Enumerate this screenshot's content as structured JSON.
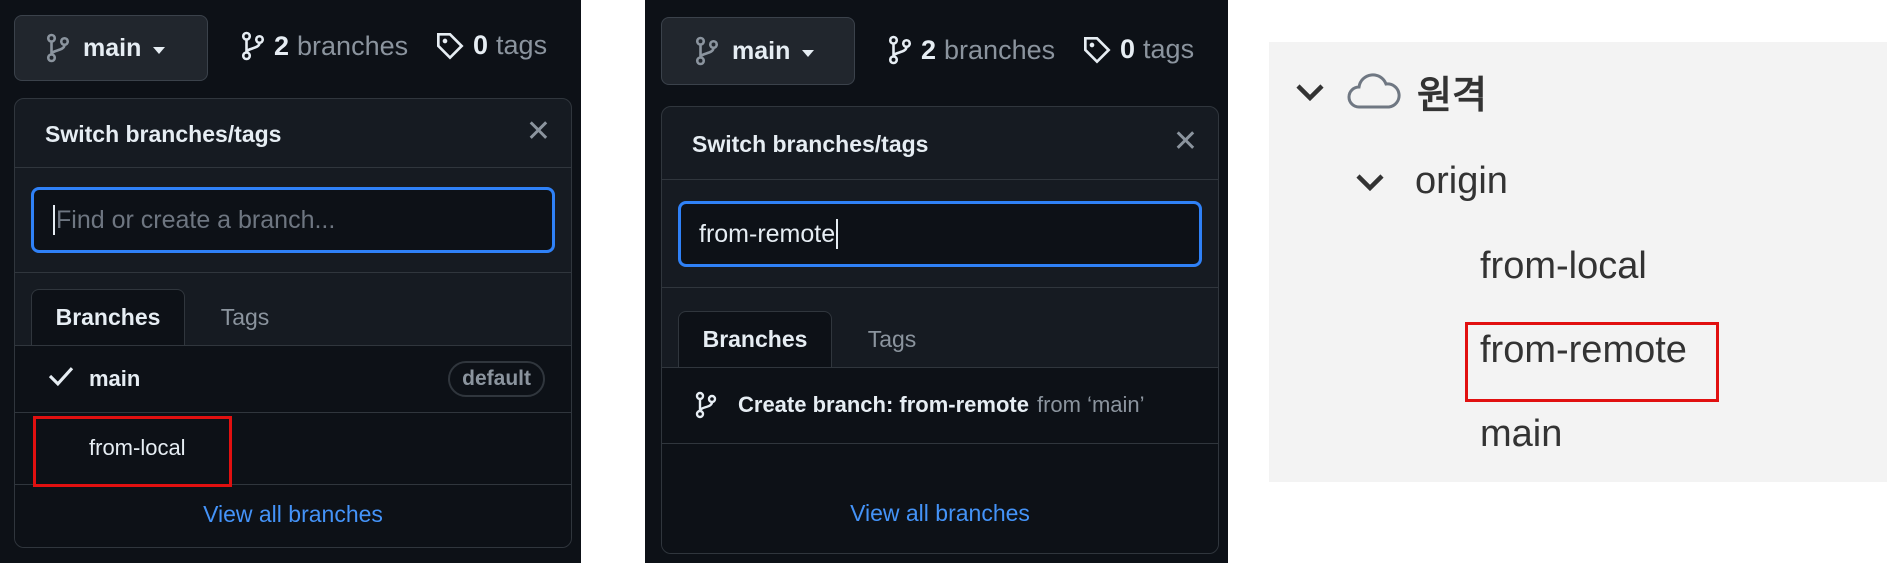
{
  "panel1": {
    "branch_button": "main",
    "branch_count": "2",
    "branches_word": "branches",
    "tag_count": "0",
    "tags_word": "tags",
    "dropdown_title": "Switch branches/tags",
    "search_placeholder": "Find or create a branch...",
    "tabs": [
      "Branches",
      "Tags"
    ],
    "branch_list": [
      {
        "name": "main",
        "badge": "default"
      },
      {
        "name": "from-local"
      }
    ],
    "view_all": "View all branches"
  },
  "panel2": {
    "branch_button": "main",
    "branch_count": "2",
    "branches_word": "branches",
    "tag_count": "0",
    "tags_word": "tags",
    "dropdown_title": "Switch branches/tags",
    "search_value": "from-remote",
    "tabs": [
      "Branches",
      "Tags"
    ],
    "create_branch_label": "Create branch: from-remote",
    "create_branch_from": "from ‘main’",
    "view_all": "View all branches"
  },
  "panel3": {
    "group_label": "원격",
    "remote": "origin",
    "branches": [
      "from-local",
      "from-remote",
      "main"
    ]
  },
  "colors": {
    "dark_bg": "#0d1117",
    "dropdown_bg": "#161b22",
    "accent_blue": "#2f81f7",
    "link_blue": "#4493f8",
    "highlight_red": "#e11010"
  }
}
